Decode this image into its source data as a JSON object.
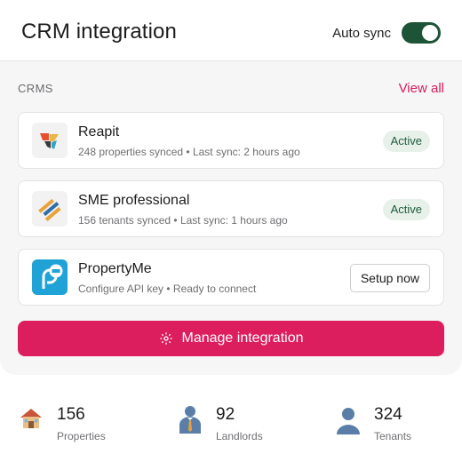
{
  "header": {
    "title": "CRM integration",
    "autosync_label": "Auto sync",
    "autosync_on": true
  },
  "crms": {
    "section_title": "CRMS",
    "view_all": "View all",
    "items": [
      {
        "name": "Reapit",
        "meta": "248 properties synced • Last sync: 2 hours ago",
        "status": "Active",
        "logo": "reapit-logo"
      },
      {
        "name": "SME professional",
        "meta": "156 tenants synced • Last sync: 1 hours ago",
        "status": "Active",
        "logo": "sme-logo"
      },
      {
        "name": "PropertyMe",
        "meta": "Configure API key • Ready to connect",
        "action": "Setup now",
        "logo": "propertyme-logo"
      }
    ]
  },
  "manage": {
    "label": "Manage integration",
    "icon": "gear-icon"
  },
  "stats": [
    {
      "value": "156",
      "label": "Properties",
      "icon": "house-icon"
    },
    {
      "value": "92",
      "label": "Landlords",
      "icon": "landlord-icon"
    },
    {
      "value": "324",
      "label": "Tenants",
      "icon": "tenant-icon"
    }
  ],
  "colors": {
    "accent": "#dc1d5e",
    "toggle": "#1d5336",
    "badge_bg": "#e7f1ea",
    "badge_text": "#1f5b3a"
  }
}
